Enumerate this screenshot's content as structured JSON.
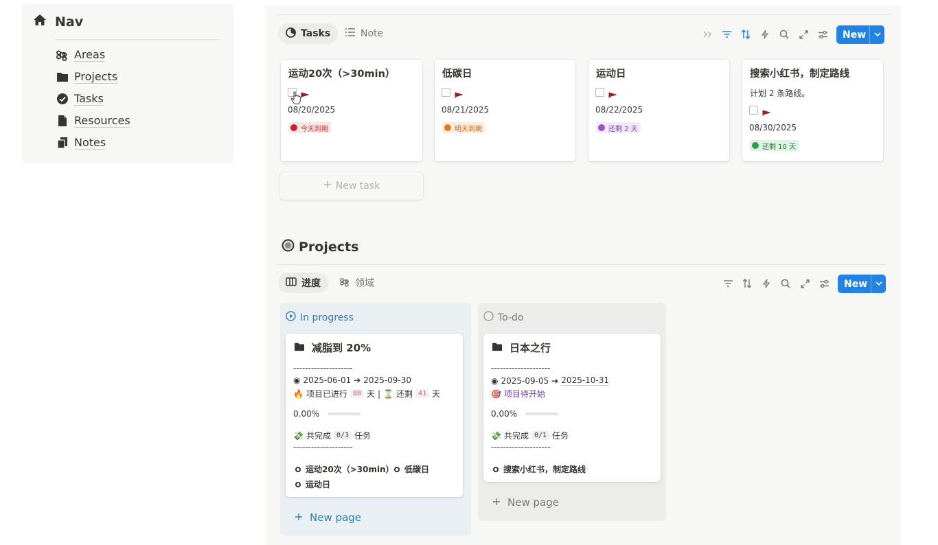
{
  "nav": {
    "title": "Nav",
    "items": [
      {
        "label": "Areas",
        "icon": "command-icon"
      },
      {
        "label": "Projects",
        "icon": "folder-icon"
      },
      {
        "label": "Tasks",
        "icon": "check-circle-icon"
      },
      {
        "label": "Resources",
        "icon": "document-icon"
      },
      {
        "label": "Notes",
        "icon": "notes-icon"
      }
    ]
  },
  "tasks_view": {
    "tabs": [
      {
        "label": "Tasks"
      },
      {
        "label": "Note"
      }
    ],
    "new_label": "New",
    "cards": [
      {
        "title": "运动20次（>30min）",
        "description": "",
        "date": "08/20/2025",
        "badge": "今天到期",
        "badge_color": "#e03e3e"
      },
      {
        "title": "低碳日",
        "description": "",
        "date": "08/21/2025",
        "badge": "明天到期",
        "badge_color": "#e8833a"
      },
      {
        "title": "运动日",
        "description": "",
        "date": "08/22/2025",
        "badge": "还剩 2 天",
        "badge_color": "#9d4fd4"
      },
      {
        "title": "搜索小红书，制定路线",
        "description": "计划 2 条路线。",
        "date": "08/30/2025",
        "badge": "还剩 10 天",
        "badge_color": "#2e9e44"
      }
    ],
    "new_task_label": "New task"
  },
  "projects_view": {
    "title": "Projects",
    "tabs": [
      {
        "label": "进度"
      },
      {
        "label": "领域"
      }
    ],
    "new_label": "New",
    "columns": [
      {
        "status": "In progress",
        "status_color": "#337ea9",
        "new_page_label": "New page",
        "card": {
          "title": "减脂到 20%",
          "divider": "--------------------",
          "start": "2025-06-01",
          "end": "2025-09-30",
          "elapsed_prefix": "项目已进行",
          "elapsed_days": "88",
          "day_unit": "天",
          "sep": "|",
          "remain_prefix": "还剩",
          "remain_days": "41",
          "progress": "0.00%",
          "done_prefix": "共完成",
          "done_count": "0/3",
          "done_suffix": "任务",
          "tasks": [
            "运动20次（>30min）",
            "低碳日",
            "运动日"
          ]
        }
      },
      {
        "status": "To-do",
        "status_color": "#787774",
        "new_page_label": "New page",
        "card": {
          "title": "日本之行",
          "divider": "--------------------",
          "start": "2025-09-05",
          "end": "2025-10-31",
          "not_started": "项目待开始",
          "progress": "0.00%",
          "done_prefix": "共完成",
          "done_count": "0/1",
          "done_suffix": "任务",
          "tasks": [
            "搜索小红书，制定路线"
          ]
        }
      }
    ]
  }
}
